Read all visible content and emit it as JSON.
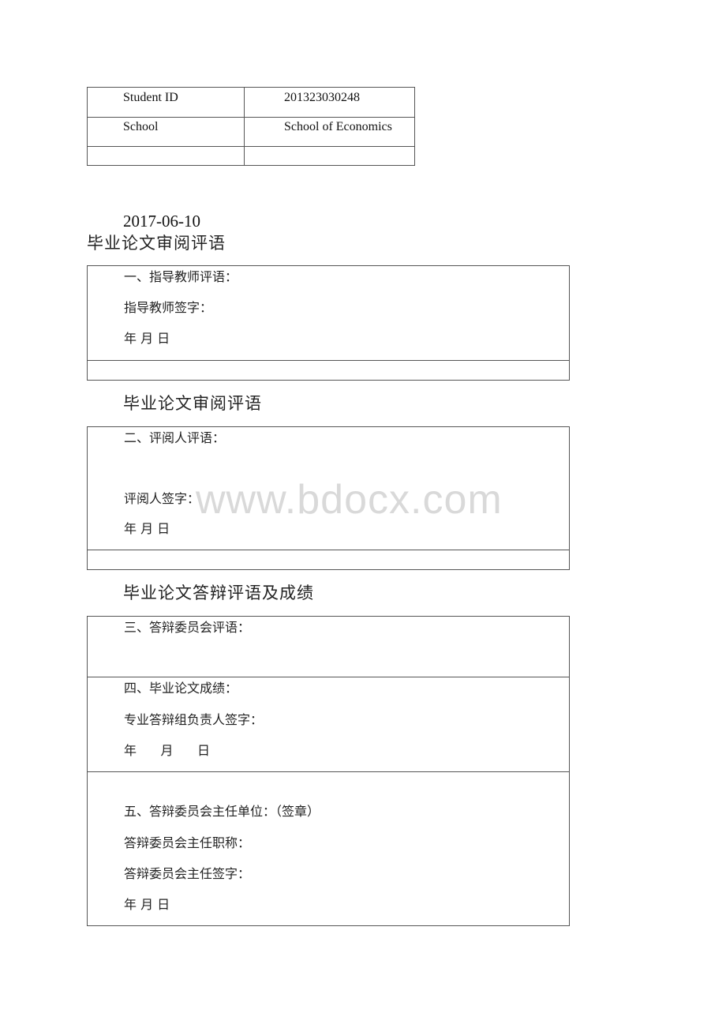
{
  "info_table": {
    "rows": [
      {
        "label": "Student ID",
        "value": "201323030248"
      },
      {
        "label": "School",
        "value": "School of Economics"
      },
      {
        "label": "",
        "value": ""
      }
    ]
  },
  "date": "2017-06-10",
  "section1": {
    "title": "毕业论文审阅评语",
    "comment_label": "一、指导教师评语：",
    "signature_label": "指导教师签字：",
    "date_label": "年 月 日"
  },
  "section2": {
    "title": "毕业论文审阅评语",
    "comment_label": "二、评阅人评语：",
    "signature_label": "评阅人签字：",
    "date_label": "年 月 日"
  },
  "section3": {
    "title": "毕业论文答辩评语及成绩",
    "committee_comment_label": "三、答辩委员会评语：",
    "grade_label": "四、毕业论文成绩：",
    "group_leader_signature_label": "专业答辩组负责人签字：",
    "grade_date_label": "年      月      日",
    "chair_unit_label": "五、答辩委员会主任单位：（签章）",
    "chair_title_label": "答辩委员会主任职称：",
    "chair_signature_label": "答辩委员会主任签字：",
    "chair_date_label": "年 月 日"
  },
  "watermark": "www.bdocx.com"
}
